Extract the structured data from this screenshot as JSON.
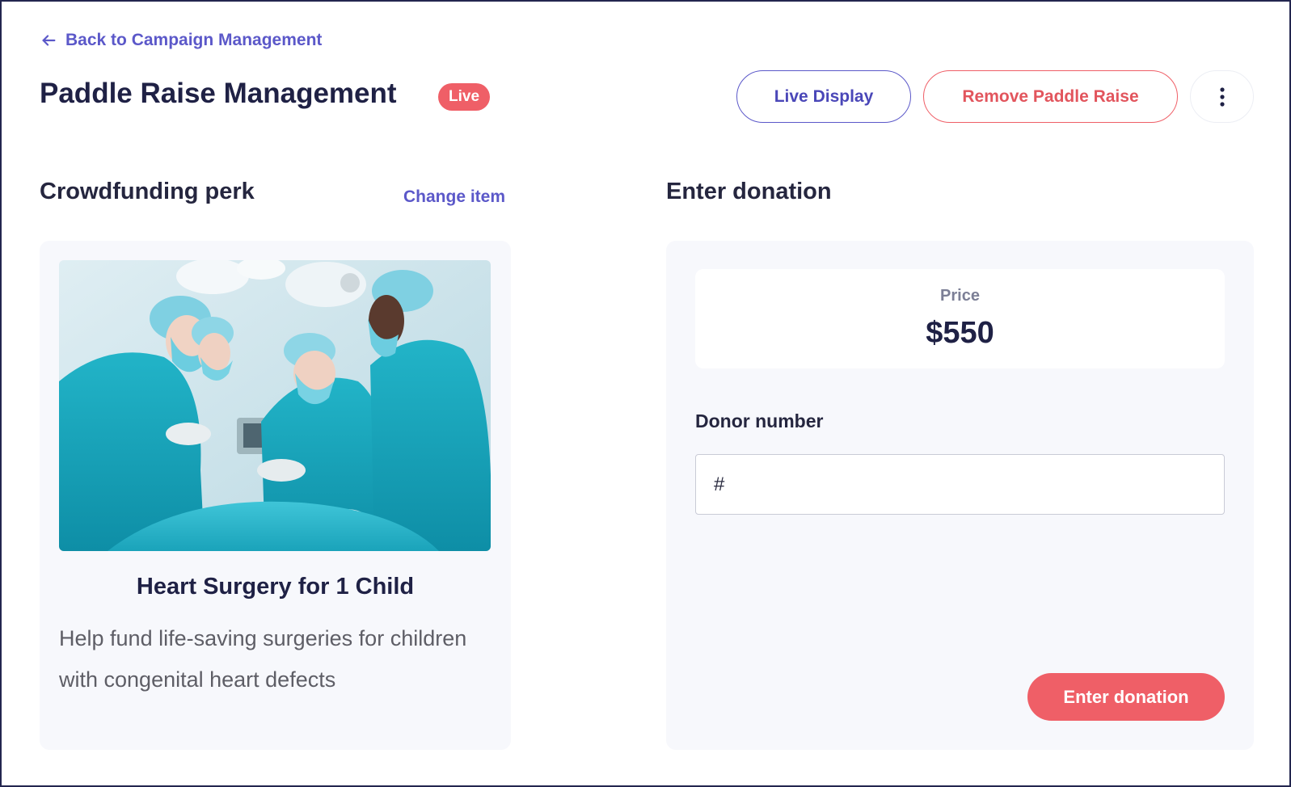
{
  "nav": {
    "back_label": "Back to Campaign Management"
  },
  "header": {
    "title": "Paddle Raise Management",
    "status_badge": "Live",
    "live_display_label": "Live Display",
    "remove_label": "Remove Paddle Raise",
    "more_icon": "more-vertical-icon"
  },
  "perk": {
    "heading": "Crowdfunding perk",
    "change_label": "Change item",
    "image_alt": "surgeons-operating-photo",
    "title": "Heart Surgery for 1 Child",
    "description": "Help fund life-saving surgeries for children with congenital heart defects"
  },
  "donation": {
    "heading": "Enter donation",
    "price_label": "Price",
    "price_value": "$550",
    "donor_label": "Donor number",
    "donor_placeholder": "#",
    "donor_value": "",
    "submit_label": "Enter donation"
  },
  "colors": {
    "accent_purple": "#5b58c9",
    "accent_red": "#ef5f67",
    "title_navy": "#1f2145",
    "card_bg": "#f7f8fc"
  }
}
